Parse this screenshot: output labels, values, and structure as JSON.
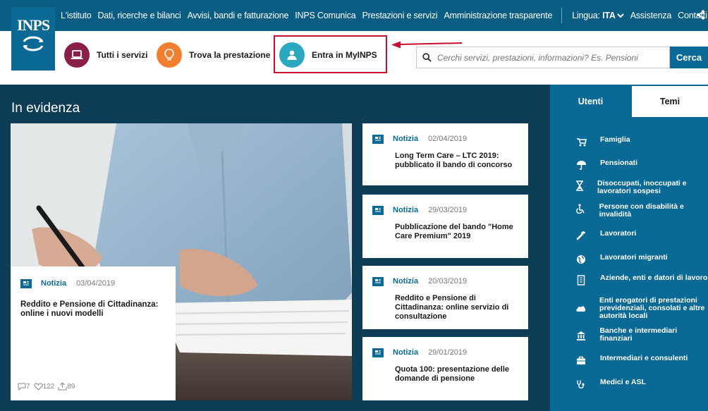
{
  "logo": {
    "text": "INPS"
  },
  "topnav": {
    "links": [
      "L'istituto",
      "Dati, ricerche e bilanci",
      "Avvisi, bandi e fatturazione",
      "INPS Comunica",
      "Prestazioni e servizi",
      "Amministrazione trasparente"
    ],
    "lang_label": "Lingua:",
    "lang_value": "ITA",
    "assistance": "Assistenza",
    "contacts": "Contatti"
  },
  "quicklinks": [
    {
      "label": "Tutti i servizi",
      "color": "#8a1f4a"
    },
    {
      "label": "Trova la prestazione",
      "color": "#f08030"
    },
    {
      "label": "Entra in MyINPS",
      "color": "#2aa8c0"
    }
  ],
  "search": {
    "placeholder": "Cerchi servizi, prestazioni, informazioni? Es. Pensioni",
    "button": "Cerca"
  },
  "main": {
    "title": "In evidenza"
  },
  "hero_card": {
    "category": "Notizia",
    "date": "03/04/2019",
    "title": "Reddito e Pensione di Cittadinanza: online i nuovi modelli",
    "comments": "7",
    "likes": "122",
    "shares": "89"
  },
  "news": [
    {
      "category": "Notizia",
      "date": "02/04/2019",
      "title": "Long Term Care – LTC 2019: pubblicato il bando di concorso"
    },
    {
      "category": "Notizia",
      "date": "29/03/2019",
      "title": "Pubblicazione del bando \"Home Care Premium\" 2019"
    },
    {
      "category": "Notizia",
      "date": "20/03/2019",
      "title": "Reddito e Pensione di Cittadinanza: online servizio di consultazione"
    },
    {
      "category": "Notizia",
      "date": "29/01/2019",
      "title": "Quota 100: presentazione delle domande di pensione"
    }
  ],
  "sidebar": {
    "tabs": [
      "Utenti",
      "Temi"
    ],
    "items": [
      "Famiglia",
      "Pensionati",
      "Disoccupati, inoccupati e lavoratori sospesi",
      "Persone con disabilità e invalidità",
      "Lavoratori",
      "Lavoratori migranti",
      "Aziende, enti e datori di lavoro",
      "Enti erogatori di prestazioni previdenziali, consolati e altre autorità locali",
      "Banche e intermediari finanziari",
      "Intermediari e consulenti",
      "Medici e ASL"
    ]
  },
  "colors": {
    "brand": "#0a6a95",
    "dark": "#0d3d56",
    "highlight": "#c8102e"
  }
}
